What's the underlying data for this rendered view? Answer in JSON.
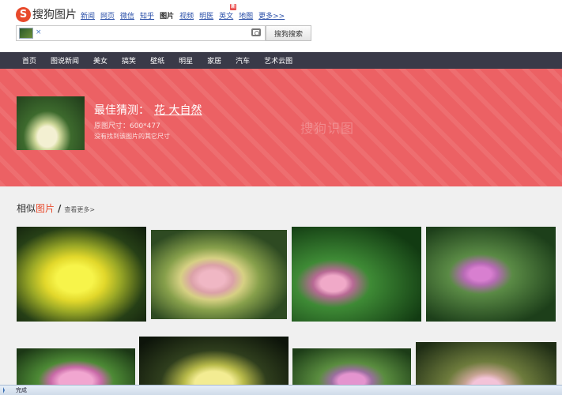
{
  "logo": {
    "mark": "S",
    "text": "搜狗图片"
  },
  "nav": {
    "links": [
      "新闻",
      "网页",
      "微信",
      "知乎",
      "图片",
      "视频",
      "明医",
      "英文",
      "地图",
      "更多>>"
    ],
    "active_index": 4,
    "badge": "新"
  },
  "search": {
    "query": "",
    "close_glyph": "×",
    "button_label": "搜狗搜索"
  },
  "categories": [
    "首页",
    "图说新闻",
    "美女",
    "搞笑",
    "壁纸",
    "明星",
    "家居",
    "汽车",
    "艺术云图"
  ],
  "hero": {
    "guess_label": "最佳猜测：",
    "guess_link": "花 大自然",
    "size_text": "原图尺寸：600*477",
    "no_other_sizes": "没有找到该图片的其它尺寸",
    "watermark": "搜狗识图"
  },
  "similar": {
    "title_prefix": "相似",
    "title_highlight": "图片",
    "slash": "/",
    "more_label": "查看更多>"
  },
  "statusbar": {
    "text": "完成"
  },
  "colors": {
    "hero_bg": "#ec6164",
    "catbar_bg": "#3a3a48",
    "link": "#2a4fa8",
    "brand": "#e8492b"
  }
}
